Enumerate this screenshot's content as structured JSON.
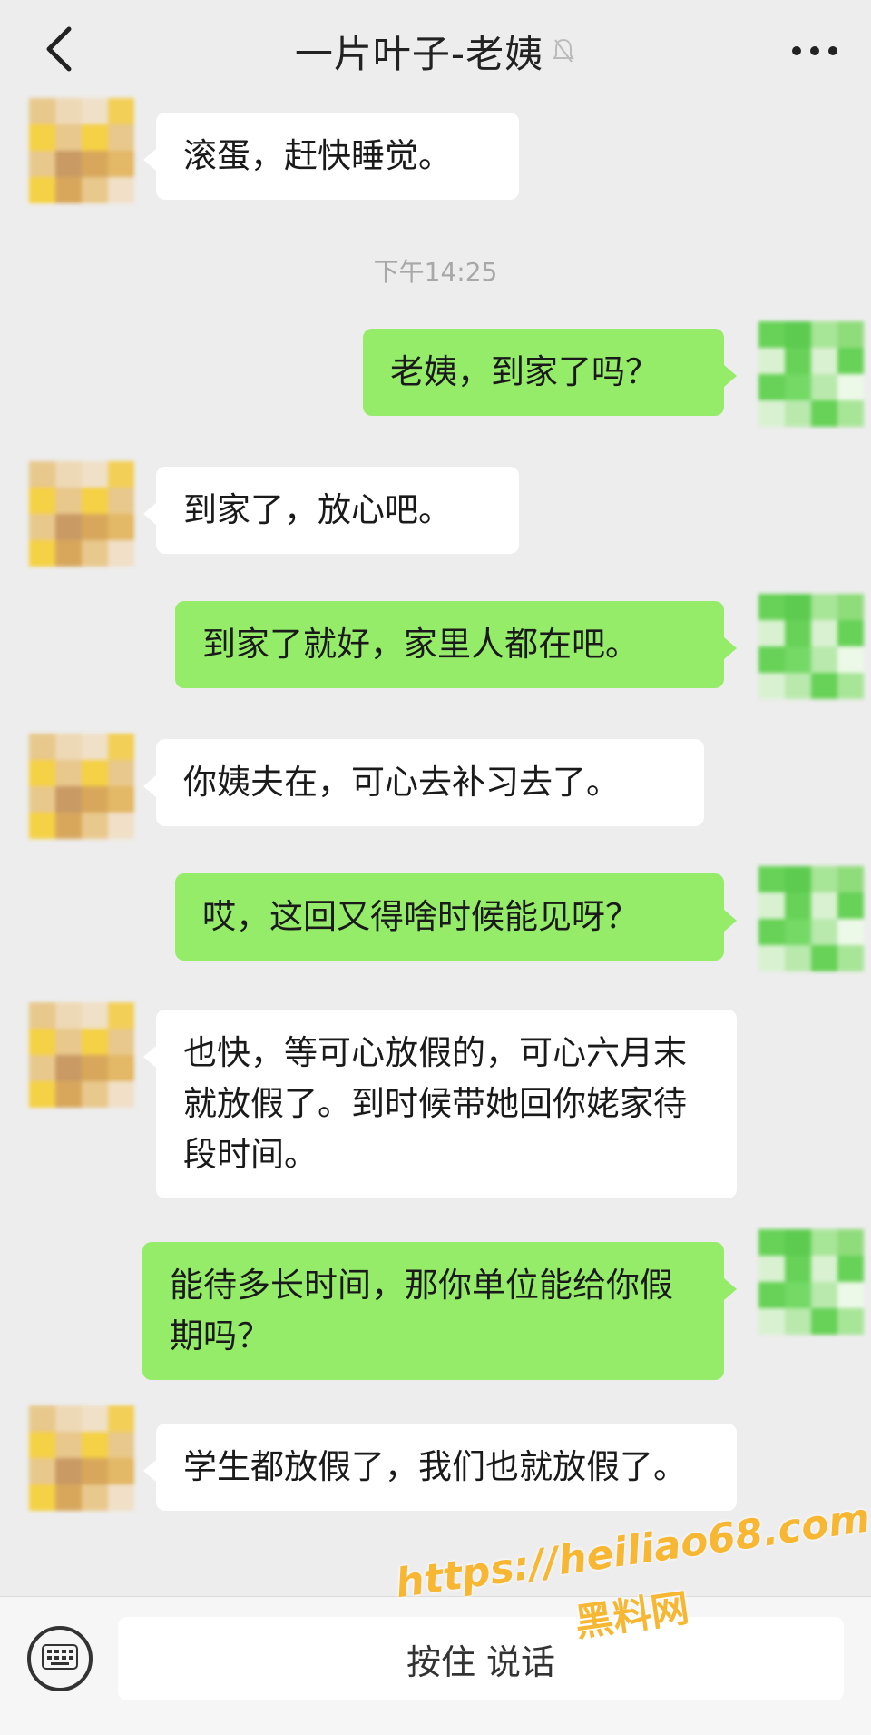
{
  "header": {
    "title": "一片叶子-老姨",
    "back_icon": "chevron-left-icon",
    "more_icon": "more-dots-icon",
    "mute_icon": "bell-muted-icon"
  },
  "timestamp": "下午14:25",
  "messages": [
    {
      "side": "in",
      "text": "滚蛋，赶快睡觉。"
    },
    {
      "side": "out",
      "text": "老姨，到家了吗？"
    },
    {
      "side": "in",
      "text": "到家了，放心吧。"
    },
    {
      "side": "out",
      "text": "到家了就好，家里人都在吧。"
    },
    {
      "side": "in",
      "text": "你姨夫在，可心去补习去了。"
    },
    {
      "side": "out",
      "text": "哎，这回又得啥时候能见呀？"
    },
    {
      "side": "in",
      "text": "也快，等可心放假的，可心六月末就放假了。到时候带她回你姥家待段时间。"
    },
    {
      "side": "out",
      "text": "能待多长时间，那你单位能给你假期吗？"
    },
    {
      "side": "in",
      "text": "学生都放假了，我们也就放假了。"
    }
  ],
  "bottom_bar": {
    "keyboard_icon": "keyboard-icon",
    "hold_to_talk": "按住 说话"
  },
  "watermark": {
    "url": "https://heiliao68.com",
    "name": "黑料网"
  },
  "colors": {
    "background": "#ededed",
    "incoming_bubble": "#ffffff",
    "outgoing_bubble": "#95ec69",
    "timestamp_text": "#a8a8a8",
    "watermark": "#f7b733"
  }
}
